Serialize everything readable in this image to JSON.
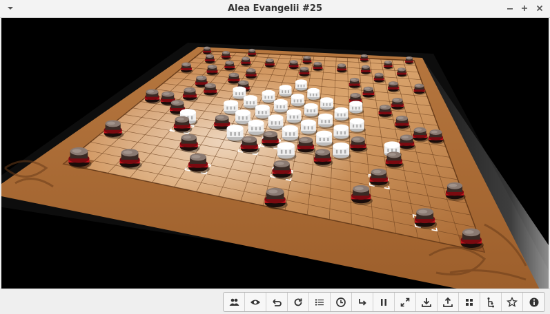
{
  "window": {
    "title": "Alea Evangelii #25",
    "menu_icon": "chevron-down-icon",
    "controls": [
      "minimize-icon",
      "maximize-icon",
      "close-icon"
    ]
  },
  "game": {
    "name": "Alea Evangelii",
    "board_size": 19,
    "colors": {
      "background": "#000000",
      "board": "#b9763f",
      "board_light": "#d29a63",
      "board_dark": "#8a5428",
      "grid": "#6b3f1c",
      "dark_piece": "#3a2a24",
      "dark_piece_top": "#8a7a72",
      "red_ring": "#c2111b",
      "white_piece": "#eeeeee",
      "highlight": "#ffffff"
    },
    "dark_pieces": [
      [
        0,
        0
      ],
      [
        0,
        4
      ],
      [
        0,
        14
      ],
      [
        0,
        18
      ],
      [
        1,
        2
      ],
      [
        1,
        9
      ],
      [
        1,
        16
      ],
      [
        2,
        1
      ],
      [
        2,
        4
      ],
      [
        2,
        6
      ],
      [
        2,
        8
      ],
      [
        2,
        10
      ],
      [
        2,
        12
      ],
      [
        2,
        14
      ],
      [
        2,
        17
      ],
      [
        3,
        3
      ],
      [
        3,
        9
      ],
      [
        3,
        15
      ],
      [
        4,
        0
      ],
      [
        4,
        2
      ],
      [
        4,
        5
      ],
      [
        4,
        13
      ],
      [
        4,
        16
      ],
      [
        4,
        18
      ],
      [
        5,
        4
      ],
      [
        5,
        14
      ],
      [
        6,
        2
      ],
      [
        6,
        5
      ],
      [
        6,
        13
      ],
      [
        6,
        16
      ],
      [
        7,
        3
      ],
      [
        7,
        15
      ],
      [
        8,
        2
      ],
      [
        8,
        16
      ],
      [
        9,
        0
      ],
      [
        9,
        1
      ],
      [
        9,
        17
      ],
      [
        9,
        18
      ],
      [
        10,
        2
      ],
      [
        10,
        16
      ],
      [
        11,
        5
      ],
      [
        11,
        13
      ],
      [
        12,
        3
      ],
      [
        12,
        8
      ],
      [
        12,
        10
      ],
      [
        12,
        15
      ],
      [
        13,
        7
      ],
      [
        13,
        11
      ],
      [
        14,
        0
      ],
      [
        14,
        4
      ],
      [
        14,
        14
      ],
      [
        14,
        18
      ],
      [
        15,
        9
      ],
      [
        16,
        5
      ],
      [
        16,
        13
      ],
      [
        17,
        2
      ],
      [
        17,
        16
      ],
      [
        18,
        0
      ],
      [
        18,
        9
      ],
      [
        18,
        18
      ]
    ],
    "white_pieces": [
      [
        5,
        9
      ],
      [
        6,
        8
      ],
      [
        6,
        10
      ],
      [
        7,
        7
      ],
      [
        7,
        9
      ],
      [
        7,
        11
      ],
      [
        8,
        6
      ],
      [
        8,
        8
      ],
      [
        8,
        10
      ],
      [
        8,
        12
      ],
      [
        9,
        5
      ],
      [
        9,
        7
      ],
      [
        9,
        9
      ],
      [
        9,
        11
      ],
      [
        9,
        13
      ],
      [
        10,
        6
      ],
      [
        10,
        8
      ],
      [
        10,
        10
      ],
      [
        10,
        12
      ],
      [
        11,
        7
      ],
      [
        11,
        9
      ],
      [
        11,
        11
      ],
      [
        12,
        6
      ],
      [
        12,
        12
      ],
      [
        13,
        9
      ],
      [
        11,
        3
      ],
      [
        11,
        15
      ],
      [
        7,
        5
      ],
      [
        7,
        13
      ]
    ],
    "highlighted_cells": [
      [
        12,
        3
      ],
      [
        12,
        8
      ],
      [
        13,
        7
      ],
      [
        15,
        9
      ],
      [
        16,
        5
      ],
      [
        17,
        16
      ],
      [
        14,
        14
      ]
    ]
  },
  "toolbar": {
    "buttons": [
      {
        "name": "players-button",
        "icon": "players-icon"
      },
      {
        "name": "view-button",
        "icon": "eye-icon"
      },
      {
        "name": "undo-button",
        "icon": "undo-icon"
      },
      {
        "name": "restart-button",
        "icon": "rotate-icon"
      },
      {
        "name": "moves-list-button",
        "icon": "list-icon"
      },
      {
        "name": "clock-button",
        "icon": "clock-icon"
      },
      {
        "name": "redo-button",
        "icon": "redo-arrow-icon"
      },
      {
        "name": "pause-button",
        "icon": "pause-icon"
      },
      {
        "name": "fullscreen-button",
        "icon": "fullscreen-icon"
      },
      {
        "name": "save-button",
        "icon": "download-icon"
      },
      {
        "name": "share-button",
        "icon": "upload-icon"
      },
      {
        "name": "layout-button",
        "icon": "grid-icon"
      },
      {
        "name": "tree-button",
        "icon": "tree-icon"
      },
      {
        "name": "favorite-button",
        "icon": "star-icon"
      },
      {
        "name": "info-button",
        "icon": "info-icon"
      }
    ]
  }
}
